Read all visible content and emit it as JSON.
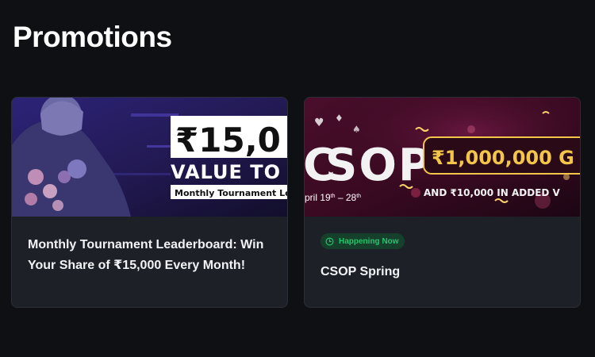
{
  "page": {
    "title": "Promotions"
  },
  "promotions": [
    {
      "title": "Monthly Tournament Leaderboard: Win Your Share of ₹15,000 Every Month!",
      "banner": {
        "amount": "₹15,0",
        "tagline": "VALUE TO BE W",
        "strip": "Monthly Tournament Leade"
      }
    },
    {
      "title": "CSOP Spring",
      "status": "Happening Now",
      "banner": {
        "brand": "SOP",
        "brand_lead": "C",
        "dates": "pril 19",
        "dates_sup1": "th",
        "dates_mid": " – 28",
        "dates_sup2": "th",
        "guarantee": "₹1,000,000 G",
        "added": "AND ₹10,000 IN ADDED V"
      }
    }
  ],
  "colors": {
    "background": "#0f1014",
    "card": "#1e2027",
    "status_green": "#22c76a",
    "banner_gold": "#f3c64a",
    "banner_purple": "#2a1a5e",
    "banner_crimson": "#3a0a1e"
  },
  "icons": {
    "status": "clock-icon"
  }
}
